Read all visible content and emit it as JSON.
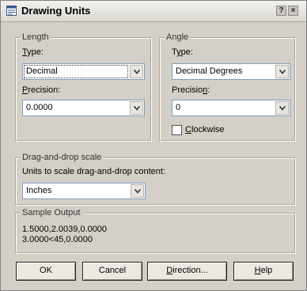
{
  "window": {
    "title": "Drawing Units",
    "help_button": "?",
    "close_button": "×"
  },
  "length": {
    "group_label": "Length",
    "type_label": "Type:",
    "type_value": "Decimal",
    "precision_label": "Precision:",
    "precision_value": "0.0000"
  },
  "angle": {
    "group_label": "Angle",
    "type_label": "Type:",
    "type_value": "Decimal Degrees",
    "precision_label": "Precision:",
    "precision_value": "0",
    "clockwise_label": "Clockwise",
    "clockwise_checked": false
  },
  "drag_drop": {
    "group_label": "Drag-and-drop scale",
    "units_label": "Units to scale drag-and-drop content:",
    "units_value": "Inches"
  },
  "sample_output": {
    "group_label": "Sample Output",
    "line1": "1.5000,2.0039,0.0000",
    "line2": "3.0000<45,0.0000"
  },
  "buttons": {
    "ok": "OK",
    "cancel": "Cancel",
    "direction": "Direction...",
    "help": "Help"
  },
  "icons": {
    "title": "units-icon",
    "dropdown": "chevron-down-icon"
  }
}
